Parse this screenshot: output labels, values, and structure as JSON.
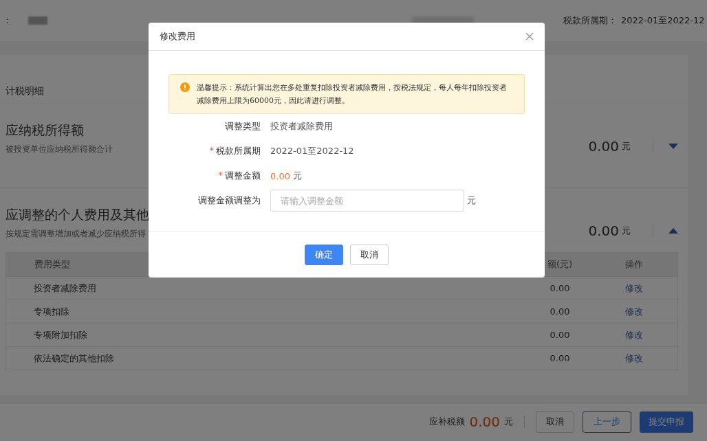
{
  "header": {
    "name_label": "：",
    "period_label": "税款所属期：",
    "period_value": "2022-01至2022-12"
  },
  "page_title": "计税明细",
  "sections": [
    {
      "title": "应纳税所得额",
      "subtitle": "被投资单位应纳税所得额合计",
      "amount": "0.00",
      "unit": "元",
      "expanded": false
    },
    {
      "title": "应调整的个人费用及其他",
      "subtitle": "按规定需调整增加或者减少应纳税所得",
      "amount": "0.00",
      "unit": "元",
      "expanded": true
    }
  ],
  "table": {
    "columns": [
      "费用类型",
      "额(元)",
      "操作"
    ],
    "rows": [
      {
        "type": "投资者减除费用",
        "amount": "0.00",
        "action": "修改"
      },
      {
        "type": "专项扣除",
        "amount": "0.00",
        "action": "修改"
      },
      {
        "type": "专项附加扣除",
        "amount": "0.00",
        "action": "修改"
      },
      {
        "type": "依法确定的其他扣除",
        "amount": "0.00",
        "action": "修改"
      }
    ]
  },
  "footer": {
    "label": "应补税额",
    "amount": "0.00",
    "unit": "元",
    "buttons": [
      {
        "label": "取消",
        "kind": "default"
      },
      {
        "label": "上一步",
        "kind": "outline"
      },
      {
        "label": "提交申报",
        "kind": "primary"
      }
    ]
  },
  "dialog": {
    "title": "修改费用",
    "warning": "温馨提示：系统计算出您在多处重复扣除投资者减除费用，按税法规定，每人每年扣除投资者减除费用上限为60000元，因此请进行调整。",
    "fields": [
      {
        "label": "调整类型",
        "kind": "text",
        "value": "投资者减除费用"
      },
      {
        "label": "税款所属期",
        "required_mark": "*",
        "kind": "text",
        "value": "2022-01至2022-12"
      },
      {
        "label": "调整金额",
        "required_mark": "*",
        "kind": "amount",
        "value": "0.00",
        "unit": "元"
      },
      {
        "label": "调整金额调整为",
        "kind": "input",
        "placeholder": "请输入调整金额",
        "unit": "元"
      }
    ],
    "buttons": [
      {
        "label": "确定",
        "kind": "primary"
      },
      {
        "label": "取消",
        "kind": "default"
      }
    ]
  }
}
